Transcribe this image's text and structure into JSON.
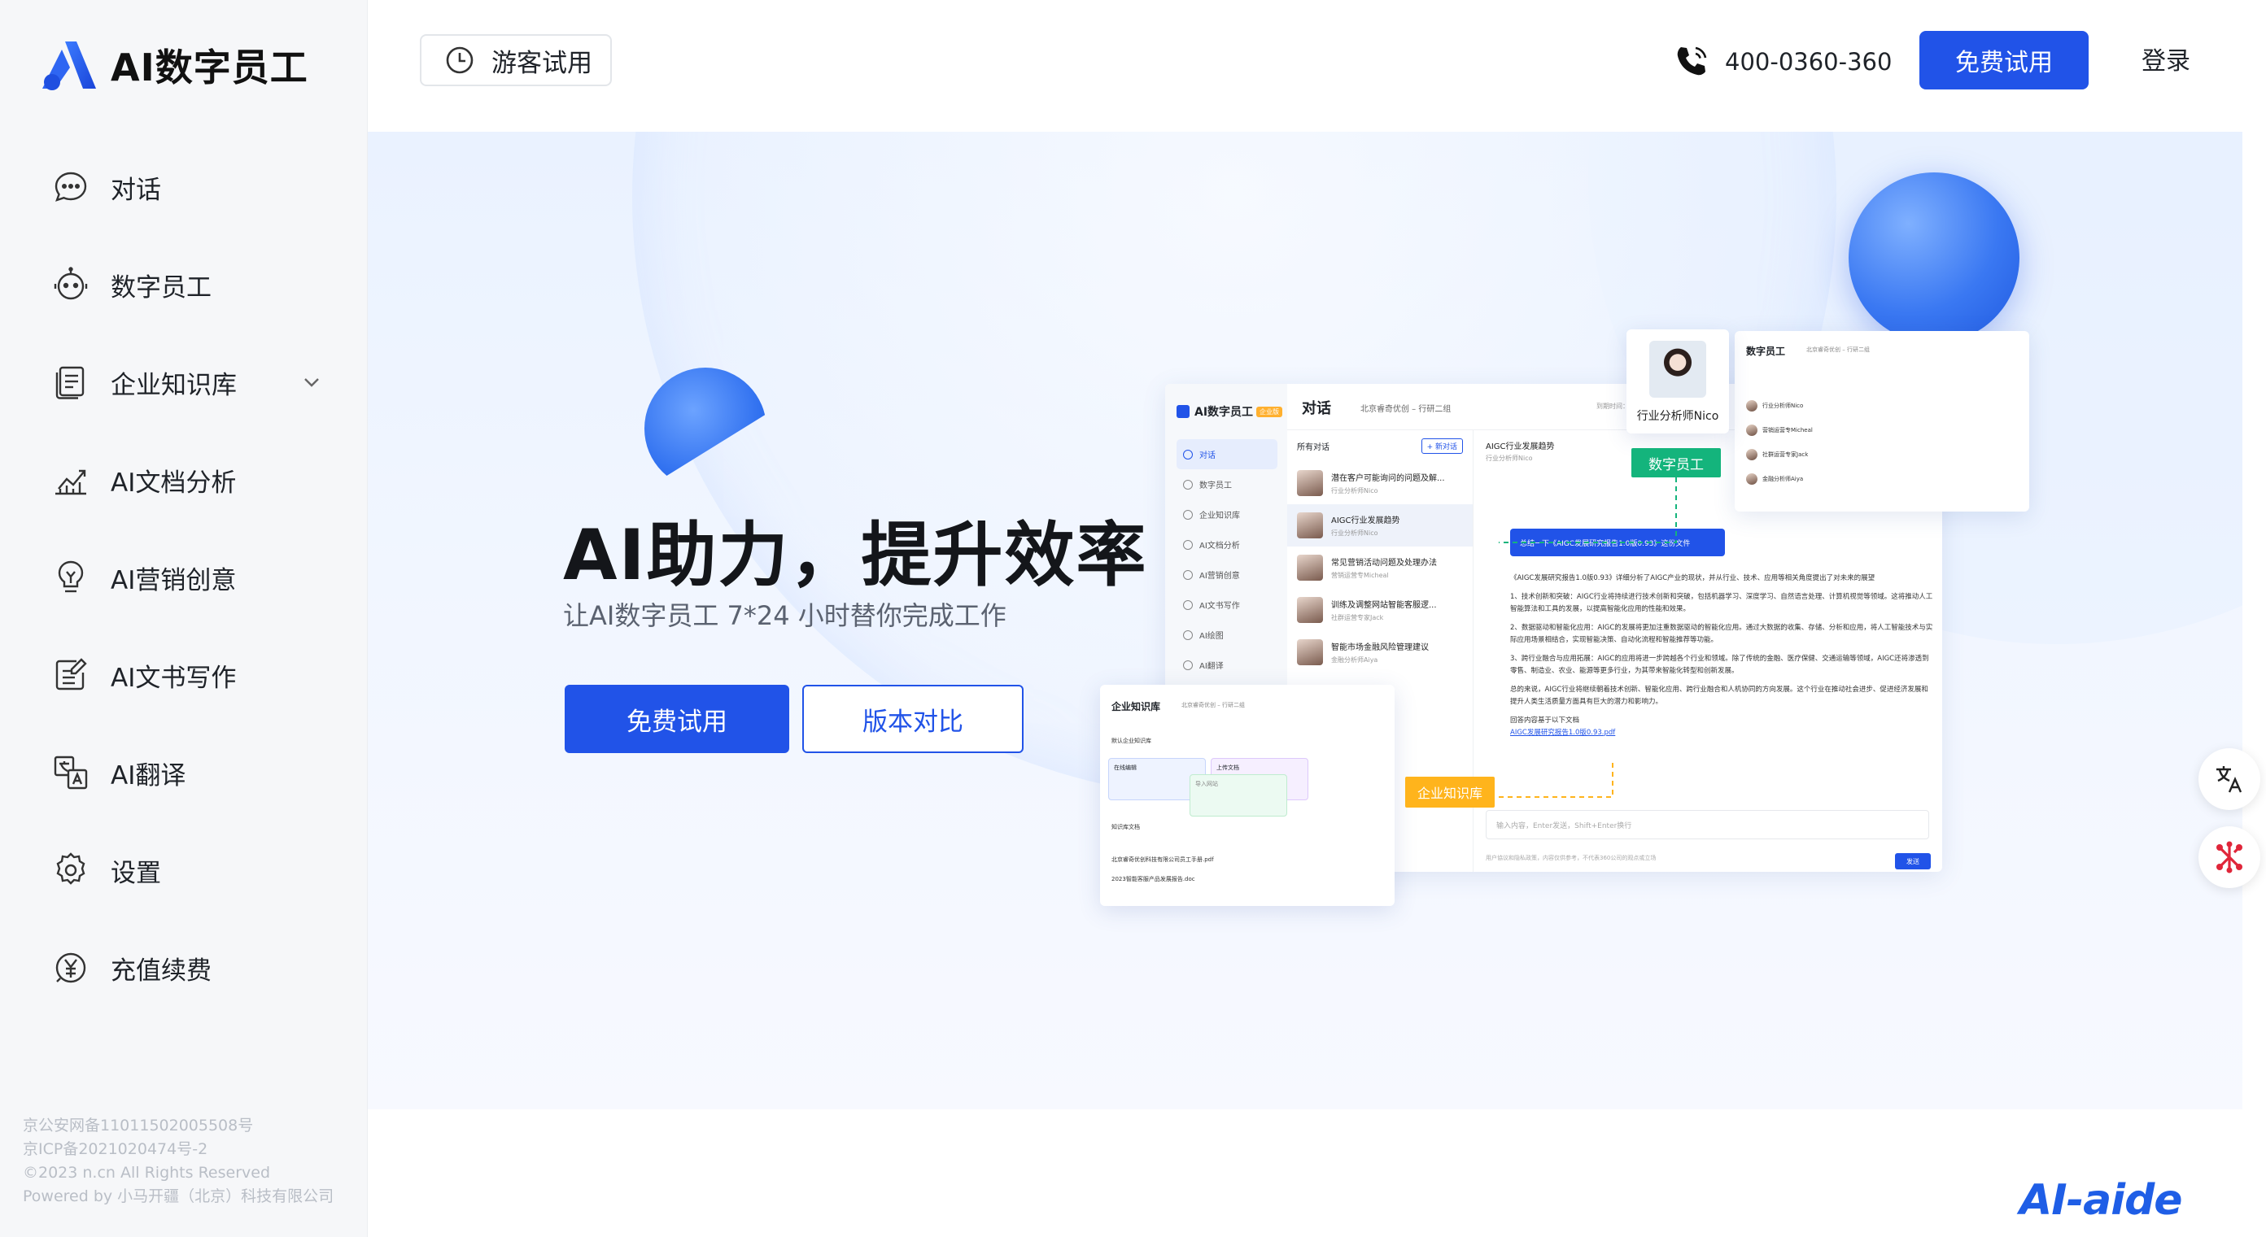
{
  "app": {
    "name": "AI数字员工"
  },
  "sidebar": {
    "items": [
      {
        "label": "对话",
        "icon": "chat-icon"
      },
      {
        "label": "数字员工",
        "icon": "robot-icon"
      },
      {
        "label": "企业知识库",
        "icon": "knowledge-base-icon",
        "expandable": true
      },
      {
        "label": "AI文档分析",
        "icon": "chart-icon"
      },
      {
        "label": "AI营销创意",
        "icon": "lightbulb-icon"
      },
      {
        "label": "AI文书写作",
        "icon": "edit-document-icon"
      },
      {
        "label": "AI翻译",
        "icon": "translate-icon"
      },
      {
        "label": "设置",
        "icon": "gear-icon"
      },
      {
        "label": "充值续费",
        "icon": "yen-icon"
      }
    ],
    "footer": [
      "京公安网备11011502005508号",
      "京ICP备2021020474号-2",
      "©2023 n.cn All Rights Reserved",
      "Powered by 小马开疆（北京）科技有限公司"
    ]
  },
  "header": {
    "guest_label": "游客试用",
    "phone": "400-0360-360",
    "trial_label": "免费试用",
    "login_label": "登录"
  },
  "hero": {
    "title": "AI助力，提升效率",
    "subtitle": "让AI数字员工 7*24 小时替你完成工作",
    "primary_label": "免费试用",
    "secondary_label": "版本对比"
  },
  "mockup": {
    "logo": "AI数字员工",
    "badge": "企业版",
    "title": "对话",
    "company": "北京睿奇优创 – 行研二组",
    "date": "到期时间：2023年12月27日",
    "nav": [
      "对话",
      "数字员工",
      "企业知识库",
      "AI文档分析",
      "AI营销创意",
      "AI文书写作",
      "AI绘图",
      "AI翻译"
    ],
    "list_title": "所有对话",
    "new_label": "+ 新对话",
    "conversations": [
      {
        "title": "潜在客户可能询问的问题及解...",
        "by": "行业分析师Nico"
      },
      {
        "title": "AIGC行业发展趋势",
        "by": "行业分析师Nico"
      },
      {
        "title": "常见营销活动问题及处理办法",
        "by": "营销运营专Micheal"
      },
      {
        "title": "训练及调整网站智能客服逻...",
        "by": "社群运营专家Jack"
      },
      {
        "title": "智能市场金融风险管理建议",
        "by": "金融分析师Aiya"
      }
    ],
    "chat_title": "AIGC行业发展趋势",
    "chat_sub": "行业分析师Nico",
    "question": "总结一下《AIGC发展研究报告1.0版0.93》这份文件",
    "answer": [
      "《AIGC发展研究报告1.0版0.93》详细分析了AIGC产业的现状，并从行业、技术、应用等相关角度提出了对未来的展望",
      "1、技术创新和突破：AIGC行业将持续进行技术创新和突破，包括机器学习、深度学习、自然语言处理、计算机视觉等领域。这将推动人工智能算法和工具的发展，以提高智能化应用的性能和效果。",
      "2、数据驱动和智能化应用：AIGC的发展将更加注重数据驱动的智能化应用。通过大数据的收集、存储、分析和应用，将人工智能技术与实际应用场景相结合，实现智能决策、自动化流程和智能推荐等功能。",
      "3、跨行业融合与应用拓展：AIGC的应用将进一步跨越各个行业和领域。除了传统的金融、医疗保健、交通运输等领域，AIGC还将渗透到零售、制造业、农业、能源等更多行业，为其带来智能化转型和创新发展。",
      "总的来说，AIGC行业将继续朝着技术创新、智能化应用、跨行业融合和人机协同的方向发展。这个行业在推动社会进步、促进经济发展和提升人类生活质量方面具有巨大的潜力和影响力。"
    ],
    "answer_ref": "回答内容基于以下文档",
    "answer_file": "AIGC发展研究报告1.0版0.93.pdf",
    "input_placeholder": "输入内容，Enter发送，Shift+Enter换行",
    "send_label": "发送",
    "footer_note": "用户協议和隐私政策，内容仅供参考，不代表360公司的观点或立场",
    "kb": {
      "title": "企业知识库",
      "company": "北京睿奇优创 – 行研二组",
      "section": "默认企业知识库",
      "cards": [
        "在线编辑",
        "上传文档",
        "导入网站"
      ],
      "docs_title": "知识库文档",
      "docs": [
        "北京睿奇优创科技有限公司员工手册.pdf",
        "2023智能客服产品发展报告.doc"
      ]
    },
    "employees": {
      "title": "数字员工",
      "company": "北京睿奇优创 – 行研二组",
      "rows": [
        "行业分析师Nico",
        "营销运营专Micheal",
        "社群运营专家Jack",
        "金融分析师Aiya"
      ]
    },
    "analyst_name": "行业分析师Nico",
    "tag_employee": "数字员工",
    "tag_kb": "企业知识库"
  },
  "brand": "AI-aide",
  "colors": {
    "primary": "#2153e8",
    "green": "#14b47c",
    "yellow": "#ffb41c"
  }
}
